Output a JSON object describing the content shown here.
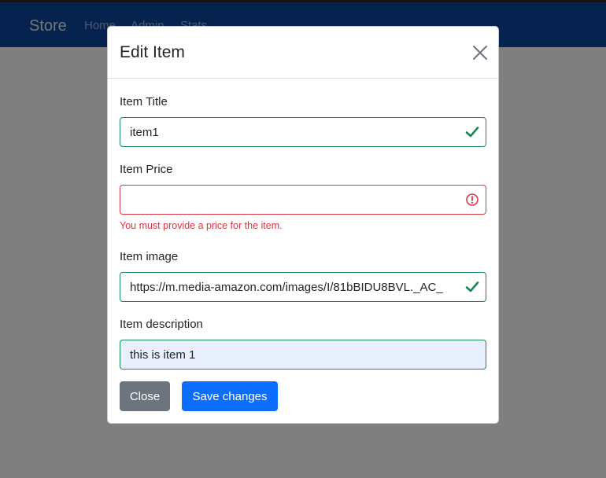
{
  "navbar": {
    "brand": "Store",
    "links": [
      "Home",
      "Admin",
      "Stats"
    ]
  },
  "modal": {
    "title": "Edit Item",
    "fields": {
      "title": {
        "label": "Item Title",
        "value": "item1",
        "state": "valid"
      },
      "price": {
        "label": "Item Price",
        "value": "",
        "state": "invalid",
        "error": "You must provide a price for the item."
      },
      "image": {
        "label": "Item image",
        "value": "https://m.media-amazon.com/images/I/81bBIDU8BVL._AC_",
        "state": "valid"
      },
      "description": {
        "label": "Item description",
        "value": "this is item 1"
      }
    },
    "buttons": {
      "close": "Close",
      "save": "Save changes"
    }
  },
  "colors": {
    "navbar": "#0d47a1",
    "valid": "#198754",
    "invalid": "#dc3545",
    "primary": "#0d6efd",
    "secondary": "#6c757d"
  },
  "icons": {
    "close": "close-icon",
    "valid": "checkmark-icon",
    "invalid": "exclamation-circle-icon"
  }
}
